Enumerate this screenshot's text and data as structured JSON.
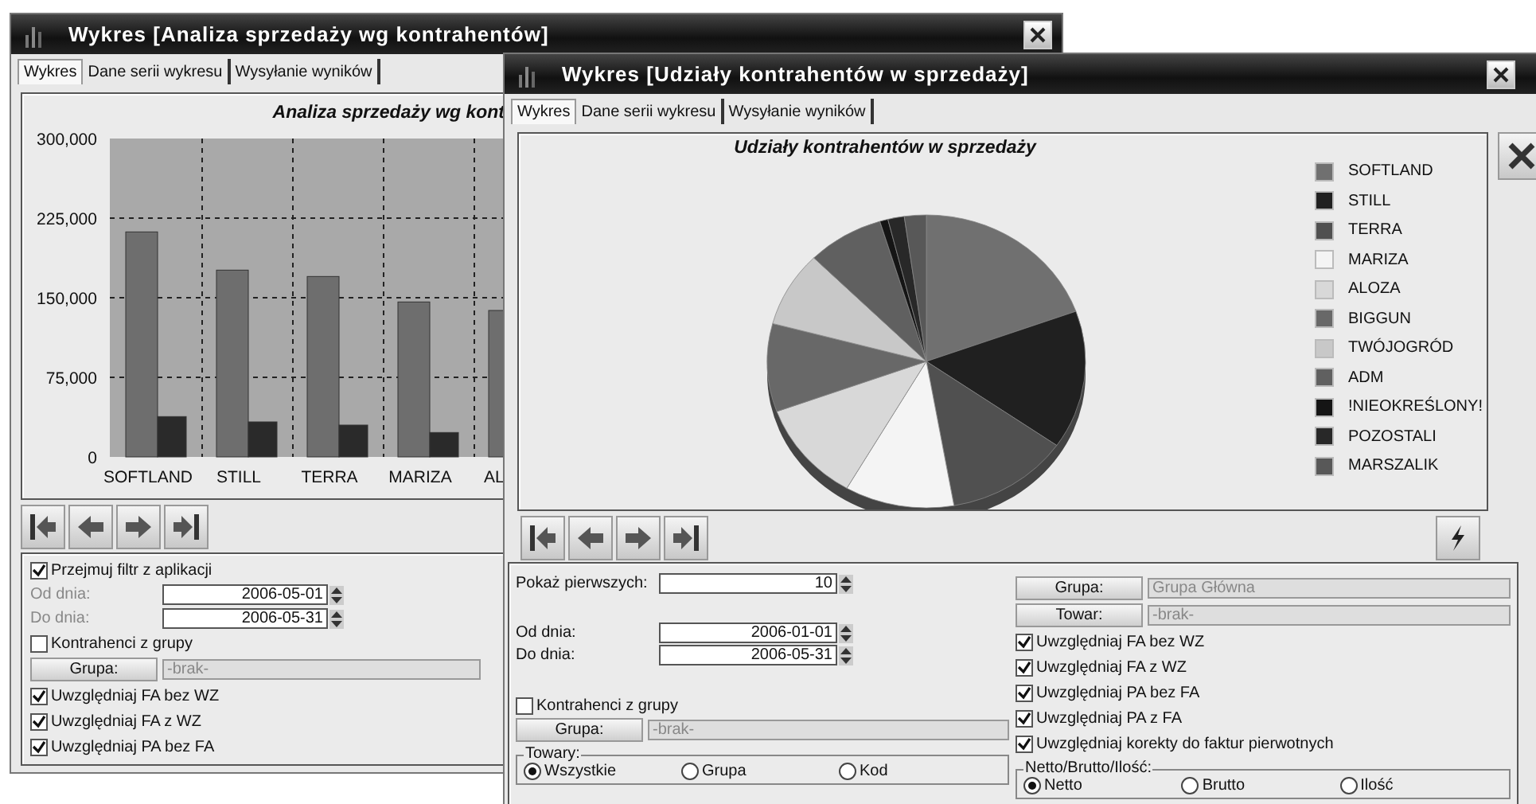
{
  "sales_window": {
    "title": "Wykres [Analiza sprzedaży wg kontrahentów]",
    "tabs": [
      {
        "label": "Wykres",
        "selected": true
      },
      {
        "label": "Dane serii wykresu",
        "selected": false
      },
      {
        "label": "Wysyłanie wyników",
        "selected": false
      }
    ],
    "chart_data": {
      "type": "bar",
      "title": "Analiza sprzedaży wg kont",
      "categories": [
        "SOFTLAND",
        "STILL",
        "TERRA",
        "MARIZA",
        "AL"
      ],
      "series": [
        {
          "color": "#6e6e6e",
          "values": [
            212000,
            176000,
            170000,
            146000,
            138000
          ]
        },
        {
          "color": "#2a2a2a",
          "values": [
            38000,
            33000,
            30000,
            23000,
            null
          ]
        }
      ],
      "ylim": [
        0,
        300000
      ],
      "grid": true,
      "yticks": [
        {
          "value": 0,
          "label": "0"
        },
        {
          "value": 75000,
          "label": "75,000"
        },
        {
          "value": 150000,
          "label": "150,000"
        },
        {
          "value": 225000,
          "label": "225,000"
        },
        {
          "value": 300000,
          "label": "300,000"
        }
      ]
    },
    "filter_checkbox": {
      "label": "Przejmuj filtr z aplikacji",
      "checked": true
    },
    "date_fields": [
      {
        "label": "Od dnia:",
        "value": "2006-05-01",
        "disabled": true
      },
      {
        "label": "Do dnia:",
        "value": "2006-05-31",
        "disabled": true
      }
    ],
    "group_checkbox": {
      "label": "Kontrahenci z grupy",
      "checked": false
    },
    "group_picker": {
      "label": "Grupa:",
      "value": "-brak-"
    },
    "checkboxes": [
      {
        "label": "Uwzględniaj FA bez WZ",
        "checked": true
      },
      {
        "label": "Uwzględniaj FA z WZ",
        "checked": true
      },
      {
        "label": "Uwzględniaj PA bez FA",
        "checked": true
      }
    ]
  },
  "shares_window": {
    "title": "Wykres [Udziały kontrahentów w sprzedaży]",
    "tabs": [
      {
        "label": "Wykres",
        "selected": true
      },
      {
        "label": "Dane serii wykresu",
        "selected": false
      },
      {
        "label": "Wysyłanie wyników",
        "selected": false
      }
    ],
    "chart_title": "Udziały kontrahentów w sprzedaży",
    "legend": [
      {
        "label": "SOFTLAND",
        "color": "#707070"
      },
      {
        "label": "STILL",
        "color": "#202020"
      },
      {
        "label": "TERRA",
        "color": "#505050"
      },
      {
        "label": "MARIZA",
        "color": "#f4f4f4"
      },
      {
        "label": "ALOZA",
        "color": "#d8d8d8"
      },
      {
        "label": "BIGGUN",
        "color": "#686868"
      },
      {
        "label": "TWÓJOGRÓD",
        "color": "#c8c8c8"
      },
      {
        "label": "ADM",
        "color": "#606060"
      },
      {
        "label": "!NIEOKREŚLONY!",
        "color": "#151515"
      },
      {
        "label": "POZOSTALI",
        "color": "#282828"
      },
      {
        "label": "MARSZALIK",
        "color": "#585858"
      }
    ],
    "show_first": {
      "label": "Pokaż pierwszych:",
      "value": "10"
    },
    "date_fields": [
      {
        "label": "Od dnia:",
        "value": "2006-01-01"
      },
      {
        "label": "Do dnia:",
        "value": "2006-05-31"
      }
    ],
    "group_checkbox": {
      "label": "Kontrahenci z grupy",
      "checked": false
    },
    "group_picker": {
      "label": "Grupa:",
      "value": "-brak-"
    },
    "products_group": {
      "title": "Towary:",
      "options": [
        {
          "label": "Wszystkie",
          "selected": true
        },
        {
          "label": "Grupa",
          "selected": false
        },
        {
          "label": "Kod",
          "selected": false
        }
      ]
    },
    "pickers": [
      {
        "label": "Grupa:",
        "value": "Grupa Główna"
      },
      {
        "label": "Towar:",
        "value": "-brak-"
      }
    ],
    "checkboxes": [
      {
        "label": "Uwzględniaj FA bez WZ",
        "checked": true
      },
      {
        "label": "Uwzględniaj FA z WZ",
        "checked": true
      },
      {
        "label": "Uwzględniaj PA bez FA",
        "checked": true
      },
      {
        "label": "Uwzględniaj PA z FA",
        "checked": true
      },
      {
        "label": "Uwzględniaj korekty do faktur pierwotnych",
        "checked": true
      }
    ],
    "amount_group": {
      "title": "Netto/Brutto/Ilość:",
      "options": [
        {
          "label": "Netto",
          "selected": true
        },
        {
          "label": "Brutto",
          "selected": false
        },
        {
          "label": "Ilość",
          "selected": false
        }
      ]
    }
  }
}
